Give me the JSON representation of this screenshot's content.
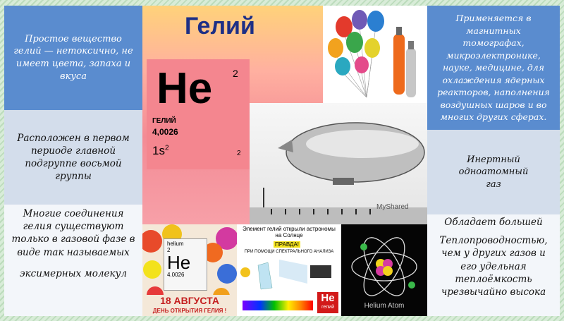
{
  "card": {
    "title": "Гелий",
    "symbol": "He",
    "number": "2",
    "name": "ГЕЛИЙ",
    "mass": "4,0026",
    "config": "1s",
    "config_sup": "2",
    "config_right": "2"
  },
  "left": {
    "p1": "Простое вещество гелий — нетоксично, не имеет цвета, запаха и вкуса",
    "p2": "Расположен в первом периоде главной подгруппе восьмой группы",
    "p3a": "Многие соединения гелия существуют только в газовой фазе в виде так называемых",
    "p3b": "эксимерных молекул"
  },
  "right": {
    "p1": "Применяется в магнитных томографах, микроэлектронике, науке, медицине, для охлаждения ядерных реакторов, наполнения воздушных шаров и во многих других сферах.",
    "p2": "Инертный одноатомный газ",
    "p3a": "Обладает большей",
    "p3b": "Теплопроводностью, чем у других газов и его удельная теплоёмкость чрезвычайно высока"
  },
  "airship": {
    "watermark": "MyShared"
  },
  "day": {
    "small_name": "helium",
    "num": "2",
    "symbol": "He",
    "mass": "4.0026",
    "date": "18 АВГУСТА",
    "caption": "ДЕНЬ ОТКРЫТИЯ ГЕЛИЯ !"
  },
  "spectrum": {
    "line1": "Элемент гелий открыли астрономы на Солнце",
    "tag": "ПРАВДА!",
    "line2": "ПРИ ПОМОЩИ СПЕКТРАЛЬНОГО АНАЛИЗА",
    "badge_symbol": "He",
    "badge_name": "гелий"
  },
  "atom": {
    "caption": "Helium Atom"
  }
}
